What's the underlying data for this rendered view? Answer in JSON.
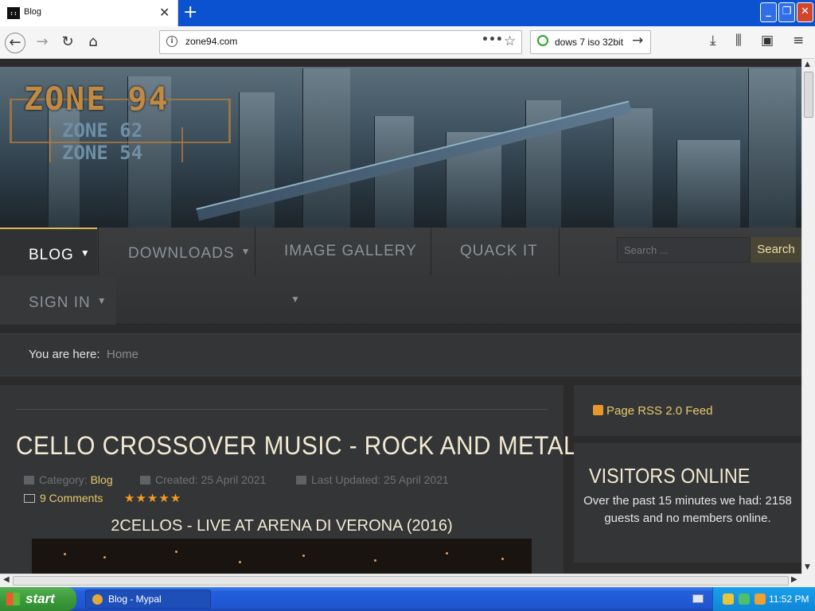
{
  "browser": {
    "tab_title": "Blog",
    "favicon_text": "::",
    "url": "zone94.com",
    "search_text": "dows 7 iso 32bit",
    "icons": [
      "back-icon",
      "forward-icon",
      "reload-icon",
      "home-icon",
      "info-icon",
      "more-icon",
      "bookmark-star-icon",
      "download-icon",
      "library-icon",
      "sidebar-icon",
      "menu-icon"
    ]
  },
  "site": {
    "logo": {
      "main": "ZONE 94",
      "sub1": "ZONE 62",
      "sub2": "ZONE 54"
    },
    "nav": {
      "blog": "BLOG",
      "downloads": "DOWNLOADS",
      "gallery": "IMAGE GALLERY",
      "quack": "QUACK IT",
      "signin": "SIGN IN"
    },
    "search": {
      "placeholder": "Search ...",
      "button": "Search"
    },
    "breadcrumb": {
      "label": "You are here:",
      "home": "Home"
    }
  },
  "article": {
    "title": "CELLO CROSSOVER MUSIC - ROCK AND METAL",
    "category_label": "Category:",
    "category": "Blog",
    "created": "Created: 25 April 2021",
    "updated": "Last Updated: 25 April 2021",
    "comments": "9 Comments",
    "rating": "★★★★★",
    "video_title": "2CELLOS - LIVE AT ARENA DI VERONA (2016)"
  },
  "sidebar": {
    "rss": "Page RSS 2.0 Feed",
    "visitors_title": "VISITORS ONLINE",
    "visitors_text": "Over the past 15 minutes we had: 2158 guests and no members online."
  },
  "taskbar": {
    "start": "start",
    "task": "Blog - Mypal",
    "clock": "11:52 PM"
  },
  "colors": {
    "accent": "#e8c96a",
    "star": "#f39c24",
    "title": "#f4ead3"
  }
}
